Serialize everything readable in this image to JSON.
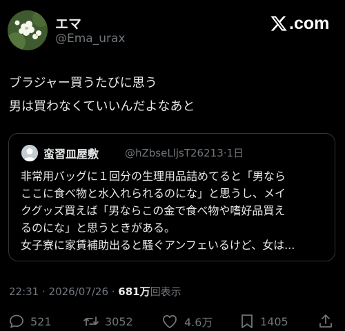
{
  "author": {
    "display_name": "エマ",
    "handle": "@Ema_urax"
  },
  "brand": {
    "text": ".com"
  },
  "tweet": {
    "lines": [
      "ブラジャー買うたびに思う",
      "男は買わなくていいんだよなあと"
    ]
  },
  "quoted": {
    "display_name": "蛮習皿屋敷",
    "handle_time": "@hZbseLljsT26213·1日",
    "lines": [
      "非常用バッグに１回分の生理用品詰めてると「男なら",
      "ここに食べ物と水入れられるのにな」と思うし、メイ",
      "クグッズ買えば「男ならこの金で食べ物や嗜好品買え",
      "るのにな」と思うときがある。",
      "女子寮に家賃補助出ると騒ぐアンフェいるけど、女は..."
    ]
  },
  "meta": {
    "timestamp": "22:31 · 2026/07/26 · ",
    "views_count": "681万",
    "views_label": "回表示"
  },
  "actions": {
    "replies": "521",
    "reposts": "3052",
    "likes": "4.6万",
    "bookmarks": "1405"
  },
  "colors": {
    "background": "#000000",
    "text": "#e7e9ea",
    "muted": "#71767b",
    "border": "#333639"
  },
  "icons": [
    "reply-icon",
    "repost-icon",
    "like-icon",
    "bookmark-icon",
    "share-icon",
    "x-logo-icon"
  ]
}
